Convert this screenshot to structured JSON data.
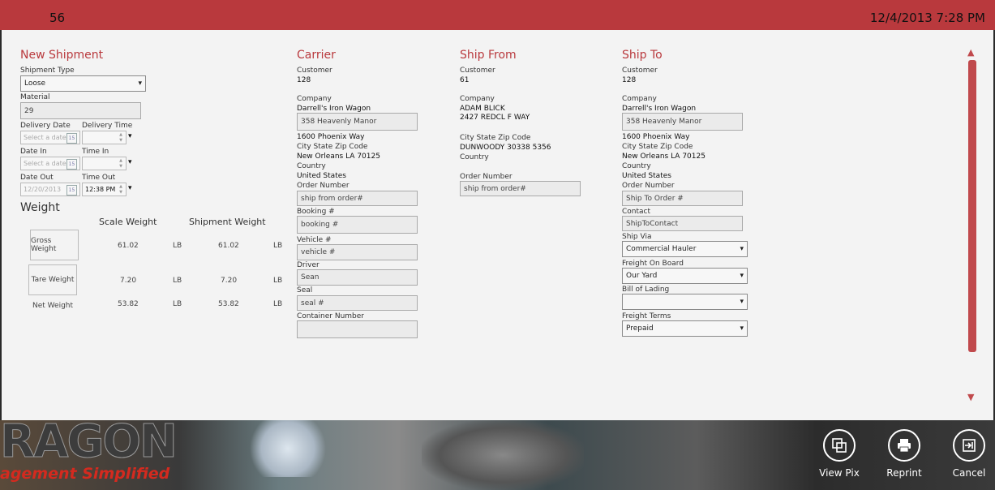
{
  "header": {
    "number": "56",
    "datetime": "12/4/2013 7:28 PM"
  },
  "new_shipment": {
    "title": "New Shipment",
    "shipment_type_label": "Shipment Type",
    "shipment_type": "Loose",
    "material_label": "Material",
    "material": "29",
    "delivery_date_label": "Delivery Date",
    "delivery_date_placeholder": "Select a date",
    "delivery_time_label": "Delivery Time",
    "date_in_label": "Date In",
    "date_in_placeholder": "Select a date",
    "time_in_label": "Time In",
    "date_out_label": "Date Out",
    "date_out": "12/20/2013",
    "time_out_label": "Time Out",
    "time_out": "12:38 PM",
    "calendar_glyph": "15"
  },
  "weight": {
    "title": "Weight",
    "scale_header": "Scale Weight",
    "shipment_header": "Shipment Weight",
    "rows": [
      {
        "label": "Gross Weight",
        "scale": "61.02",
        "scale_unit": "LB",
        "shipment": "61.02",
        "shipment_unit": "LB"
      },
      {
        "label": "Tare Weight",
        "scale": "7.20",
        "scale_unit": "LB",
        "shipment": "7.20",
        "shipment_unit": "LB"
      },
      {
        "label": "Net Weight",
        "scale": "53.82",
        "scale_unit": "LB",
        "shipment": "53.82",
        "shipment_unit": "LB"
      }
    ]
  },
  "carrier": {
    "title": "Carrier",
    "customer_label": "Customer",
    "customer": "128",
    "company_label": "Company",
    "company": "Darrell's Iron Wagon",
    "address_box": "358 Heavenly Manor",
    "address": "1600 Phoenix Way",
    "city_label": "City State Zip Code",
    "city": "New Orleans LA 70125",
    "country_label": "Country",
    "country": "United States",
    "order_label": "Order Number",
    "order_placeholder": "ship from order#",
    "booking_label": "Booking #",
    "booking_placeholder": "booking #",
    "vehicle_label": "Vehicle #",
    "vehicle_placeholder": "vehicle #",
    "driver_label": "Driver",
    "driver": "Sean",
    "seal_label": "Seal",
    "seal_placeholder": "seal #",
    "container_label": "Container Number",
    "container": ""
  },
  "ship_from": {
    "title": "Ship From",
    "customer_label": "Customer",
    "customer": "61",
    "company_label": "Company",
    "company": "ADAM BLICK",
    "address": "2427 REDCL F WAY",
    "city_label": "City State Zip Code",
    "city": "DUNWOODY 30338 5356",
    "country_label": "Country",
    "order_label": "Order Number",
    "order_placeholder": "ship from order#"
  },
  "ship_to": {
    "title": "Ship To",
    "customer_label": "Customer",
    "customer": "128",
    "company_label": "Company",
    "company": "Darrell's Iron Wagon",
    "address_box": "358 Heavenly Manor",
    "address": "1600 Phoenix Way",
    "city_label": "City State Zip Code",
    "city": "New Orleans LA 70125",
    "country_label": "Country",
    "country": "United States",
    "order_label": "Order Number",
    "order_placeholder": "Ship To Order #",
    "contact_label": "Contact",
    "contact": "ShipToContact",
    "ship_via_label": "Ship Via",
    "ship_via": "Commercial Hauler",
    "fob_label": "Freight On Board",
    "fob": "Our Yard",
    "bol_label": "Bill of Lading",
    "bol": "",
    "terms_label": "Freight Terms",
    "terms": "Prepaid"
  },
  "branding": {
    "logo_main": "RAGON",
    "logo_tagline": "agement Simplified"
  },
  "appbar": {
    "view_pix": "View Pix",
    "reprint": "Reprint",
    "cancel": "Cancel"
  },
  "colors": {
    "accent": "#b9393d",
    "panel": "#f3f3f3"
  }
}
